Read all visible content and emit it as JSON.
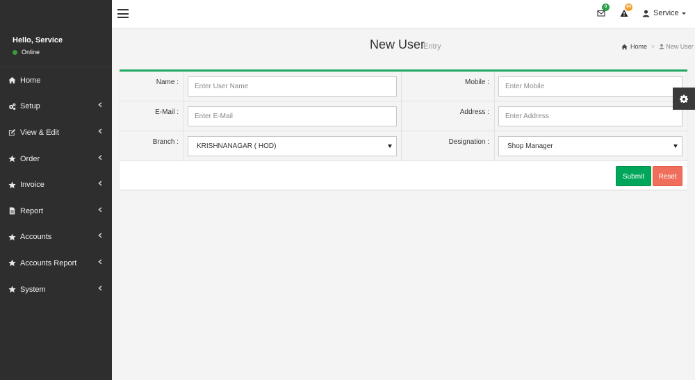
{
  "sidebar": {
    "greeting": "Hello, Service",
    "status": "Online",
    "items": [
      {
        "label": "Home",
        "icon": "home-icon"
      },
      {
        "label": "Setup",
        "icon": "gears-icon"
      },
      {
        "label": "View & Edit",
        "icon": "edit-icon"
      },
      {
        "label": "Order",
        "icon": "star-icon"
      },
      {
        "label": "Invoice",
        "icon": "star-icon"
      },
      {
        "label": "Report",
        "icon": "file-icon"
      },
      {
        "label": "Accounts",
        "icon": "star-icon"
      },
      {
        "label": "Accounts Report",
        "icon": "star-icon"
      },
      {
        "label": "System",
        "icon": "star-icon"
      }
    ]
  },
  "header": {
    "mail_count": "0",
    "alert_count": "94",
    "user_name": "Service"
  },
  "page": {
    "title": "New User",
    "subtitle": "Entry",
    "breadcrumb_home": "Home",
    "breadcrumb_sep": ">",
    "breadcrumb_current": "New User"
  },
  "form": {
    "name_label": "Name :",
    "name_placeholder": "Enter User Name",
    "mobile_label": "Mobile :",
    "mobile_placeholder": "Enter Mobile",
    "email_label": "E-Mail :",
    "email_placeholder": "Enter E-Mail",
    "address_label": "Address :",
    "address_placeholder": "Enter Address",
    "branch_label": "Branch :",
    "branch_value": "KRISHNANAGAR ( HOD)",
    "designation_label": "Designation :",
    "designation_value": "Shop Manager",
    "submit_label": "Submit",
    "reset_label": "Reset"
  },
  "colors": {
    "sidebar_bg": "#2e2e2e",
    "accent_green": "#1fa660",
    "submit": "#00a65a",
    "reset": "#f06f5c",
    "mail_badge": "#2ba24a",
    "alert_badge": "#f0a030"
  }
}
